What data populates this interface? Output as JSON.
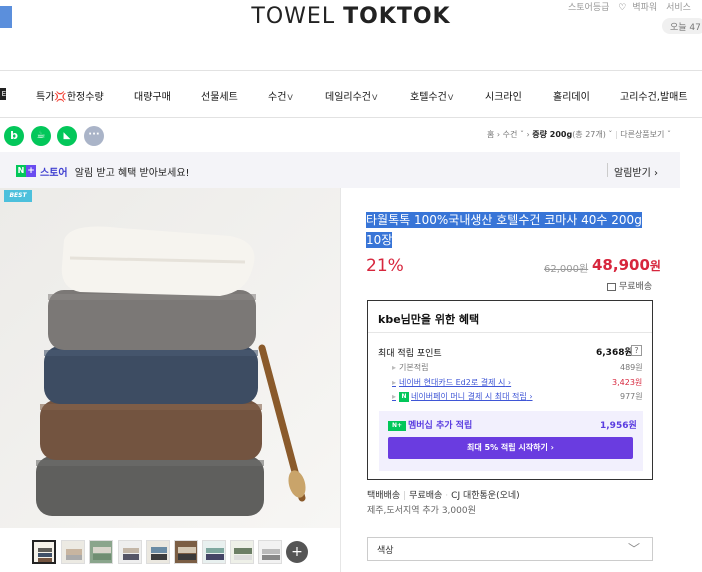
{
  "header": {
    "logo_light": "TOWEL",
    "logo_bold": "TOKTOK",
    "top_links": [
      "스토어등급",
      "벽파워",
      "서비스"
    ],
    "today_label": "오늘 47"
  },
  "nav": {
    "mark": "E",
    "items": [
      "특가💢한정수량",
      "대량구매",
      "선물세트",
      "수건",
      "데일리수건",
      "호텔수건",
      "시크라인",
      "홀리데이",
      "고리수건,발매트"
    ],
    "dropdown_caret": "ᐯ"
  },
  "share_icons": [
    {
      "name": "blog-icon",
      "glyph": "b",
      "color": "#03c75a"
    },
    {
      "name": "cafe-icon",
      "glyph": "☕",
      "color": "#03c75a"
    },
    {
      "name": "bookmark-icon",
      "glyph": "◣",
      "color": "#03c75a"
    },
    {
      "name": "more-icon",
      "glyph": "···",
      "color": "#aab4c8"
    }
  ],
  "breadcrumb": {
    "home": "홈",
    "cat": "수건",
    "current_prefix": "중량 200g",
    "current_count": "(총 27개)",
    "other": "다른상품보기"
  },
  "store_banner": {
    "badge_n": "N",
    "badge_plus": "+",
    "store_label": "스토어",
    "message": "알림 받고 혜택 받아보세요!",
    "notify_button": "알림받기"
  },
  "product": {
    "badge": "BEST",
    "title": "타월톡톡 100%국내생산 호텔수건 코마사 40수 200g 10장",
    "discount": "21%",
    "original_price": "62,000원",
    "sale_price": "48,900",
    "sale_unit": "원",
    "shipping": "무료배송"
  },
  "benefit": {
    "heading": "kbe님만을 위한 혜택",
    "max_point_label": "최대 적립 포인트",
    "max_point_value": "6,368원",
    "question": "?",
    "basic_label": "기본적립",
    "basic_value": "489원",
    "card_label": "네이버 현대카드 Ed2로 결제 시",
    "card_value": "3,423원",
    "npay_badge": "N",
    "npay_label": "네이버페이 머니 결제 시 최대 적립",
    "npay_value": "977원",
    "member_label": "멤버십 추가 적립",
    "member_value": "1,956원",
    "member_button": "최대 5% 적립 시작하기"
  },
  "delivery": {
    "type": "택배배송",
    "fee": "무료배송",
    "courier": "CJ 대한통운(오네)",
    "extra": "제주,도서지역 추가 3,000원"
  },
  "option_select": {
    "placeholder": "색상"
  },
  "thumb_colors": [
    [
      "#f5f2ea",
      "#5e5d58",
      "#3f5068"
    ],
    [
      "#eceae3",
      "#c8b5a0",
      "#aaa"
    ],
    [
      "#8aa58c",
      "#d8d5cb",
      "#6f8e72"
    ],
    [
      "#eee",
      "#c3b6a7",
      "#556"
    ],
    [
      "#ebe8e0",
      "#6b8ca5",
      "#3c3c3c"
    ],
    [
      "#7b5e44",
      "#d4c8b4",
      "#3a3a3a"
    ],
    [
      "#e8f0ef",
      "#7fa8a0",
      "#446"
    ],
    [
      "#eef0e8",
      "#6c7f66",
      "#ddd"
    ],
    [
      "#f2f2f2",
      "#bbb",
      "#888"
    ]
  ]
}
